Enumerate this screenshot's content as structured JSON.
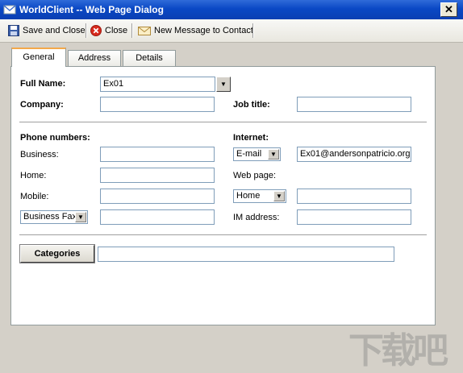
{
  "window": {
    "title": "WorldClient -- Web Page Dialog",
    "close_glyph": "✕"
  },
  "toolbar": {
    "save_close_label": "Save and Close",
    "close_label": "Close",
    "new_message_label": "New Message to Contact"
  },
  "tabs": [
    {
      "label": "General",
      "active": true
    },
    {
      "label": "Address",
      "active": false
    },
    {
      "label": "Details",
      "active": false
    }
  ],
  "form": {
    "full_name_label": "Full Name:",
    "full_name_value": "Ex01",
    "company_label": "Company:",
    "company_value": "",
    "job_title_label": "Job title:",
    "job_title_value": "",
    "phone_header": "Phone numbers:",
    "business_label": "Business:",
    "business_value": "",
    "home_label": "Home:",
    "home_value": "",
    "mobile_label": "Mobile:",
    "mobile_value": "",
    "phone_type_select": "Business Fax",
    "phone_type_value": "",
    "internet_header": "Internet:",
    "email_type_select": "E-mail",
    "email_value": "Ex01@andersonpatricio.org",
    "web_page_label": "Web page:",
    "web_type_select": "Home",
    "web_value": "",
    "im_label": "IM address:",
    "im_value": "",
    "categories_button": "Categories",
    "categories_value": ""
  },
  "watermark": {
    "text": "下载吧"
  },
  "colors": {
    "titlebar": "#0a48c5",
    "active_tab_accent": "#f3a84a",
    "input_border": "#7f9db9",
    "dialog_bg": "#d4d0c8"
  }
}
